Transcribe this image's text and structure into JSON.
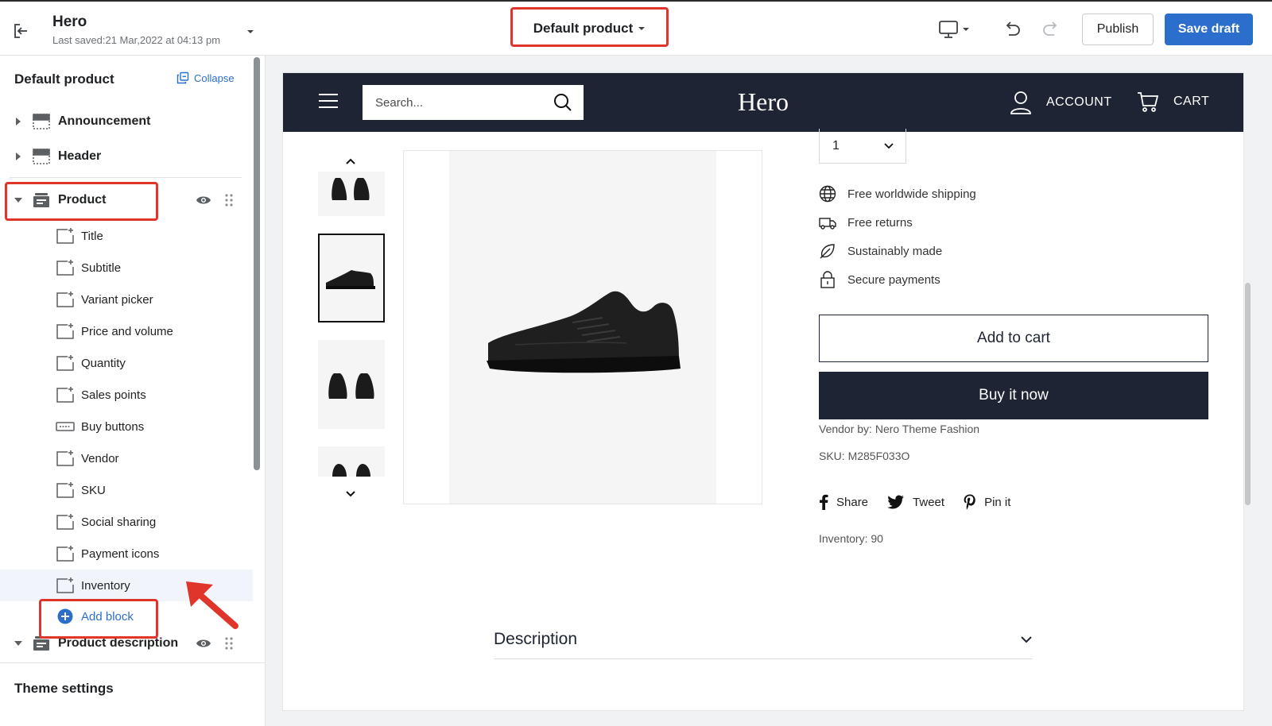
{
  "app": {
    "title": "Hero",
    "last_saved": "Last saved:21 Mar,2022 at 04:13 pm",
    "template_label": "Default product",
    "publish_label": "Publish",
    "save_label": "Save draft",
    "accent_color": "#2c6ecb"
  },
  "sidebar": {
    "heading": "Default product",
    "collapse_label": "Collapse",
    "sections": {
      "announcement": "Announcement",
      "header": "Header",
      "product": "Product",
      "product_description": "Product description"
    },
    "blocks": [
      {
        "label": "Title",
        "icon": "block-icon"
      },
      {
        "label": "Subtitle",
        "icon": "block-icon"
      },
      {
        "label": "Variant picker",
        "icon": "block-icon"
      },
      {
        "label": "Price and volume",
        "icon": "block-icon"
      },
      {
        "label": "Quantity",
        "icon": "block-icon"
      },
      {
        "label": "Sales points",
        "icon": "block-icon"
      },
      {
        "label": "Buy buttons",
        "icon": "btn-icon"
      },
      {
        "label": "Vendor",
        "icon": "block-icon"
      },
      {
        "label": "SKU",
        "icon": "block-icon"
      },
      {
        "label": "Social sharing",
        "icon": "block-icon"
      },
      {
        "label": "Payment icons",
        "icon": "block-icon"
      },
      {
        "label": "Inventory",
        "icon": "block-icon"
      }
    ],
    "add_block_label": "Add block",
    "theme_settings_label": "Theme settings"
  },
  "store": {
    "search_placeholder": "Search...",
    "logo": "Hero",
    "account_label": "ACCOUNT",
    "cart_label": "CART",
    "quantity_value": "1",
    "features": [
      "Free worldwide shipping",
      "Free returns",
      "Sustainably made",
      "Secure payments"
    ],
    "add_to_cart_label": "Add to cart",
    "buy_now_label": "Buy it now",
    "vendor_text": "Vendor by: Nero Theme Fashion",
    "sku_text": "SKU: M285F033O",
    "share_label": "Share",
    "tweet_label": "Tweet",
    "pin_label": "Pin it",
    "inventory_text": "Inventory: 90",
    "description_label": "Description",
    "nav_color": "#1e2433"
  }
}
